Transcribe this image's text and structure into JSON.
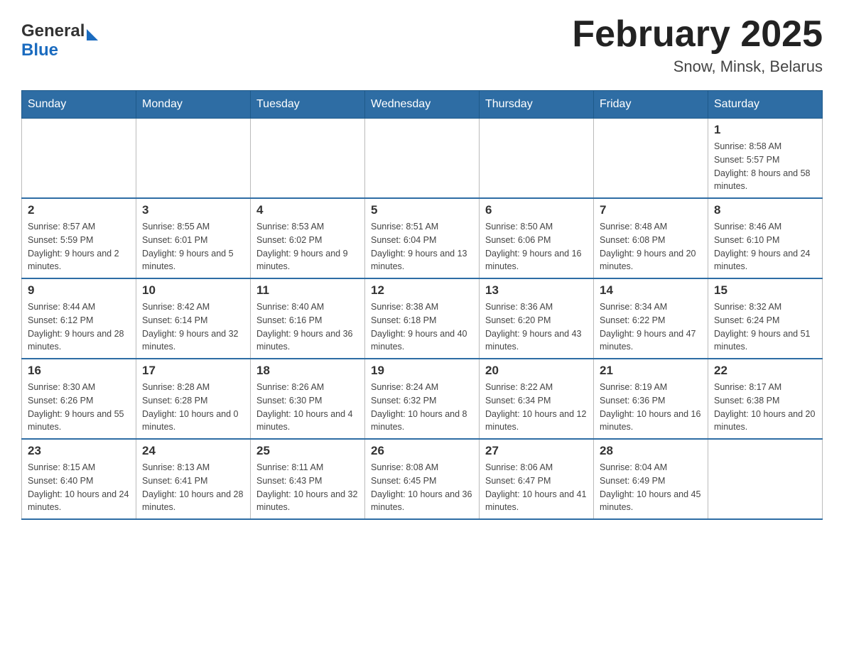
{
  "header": {
    "logo_text_general": "General",
    "logo_text_blue": "Blue",
    "title": "February 2025",
    "subtitle": "Snow, Minsk, Belarus"
  },
  "weekdays": [
    "Sunday",
    "Monday",
    "Tuesday",
    "Wednesday",
    "Thursday",
    "Friday",
    "Saturday"
  ],
  "weeks": [
    [
      {
        "day": "",
        "info": ""
      },
      {
        "day": "",
        "info": ""
      },
      {
        "day": "",
        "info": ""
      },
      {
        "day": "",
        "info": ""
      },
      {
        "day": "",
        "info": ""
      },
      {
        "day": "",
        "info": ""
      },
      {
        "day": "1",
        "info": "Sunrise: 8:58 AM\nSunset: 5:57 PM\nDaylight: 8 hours and 58 minutes."
      }
    ],
    [
      {
        "day": "2",
        "info": "Sunrise: 8:57 AM\nSunset: 5:59 PM\nDaylight: 9 hours and 2 minutes."
      },
      {
        "day": "3",
        "info": "Sunrise: 8:55 AM\nSunset: 6:01 PM\nDaylight: 9 hours and 5 minutes."
      },
      {
        "day": "4",
        "info": "Sunrise: 8:53 AM\nSunset: 6:02 PM\nDaylight: 9 hours and 9 minutes."
      },
      {
        "day": "5",
        "info": "Sunrise: 8:51 AM\nSunset: 6:04 PM\nDaylight: 9 hours and 13 minutes."
      },
      {
        "day": "6",
        "info": "Sunrise: 8:50 AM\nSunset: 6:06 PM\nDaylight: 9 hours and 16 minutes."
      },
      {
        "day": "7",
        "info": "Sunrise: 8:48 AM\nSunset: 6:08 PM\nDaylight: 9 hours and 20 minutes."
      },
      {
        "day": "8",
        "info": "Sunrise: 8:46 AM\nSunset: 6:10 PM\nDaylight: 9 hours and 24 minutes."
      }
    ],
    [
      {
        "day": "9",
        "info": "Sunrise: 8:44 AM\nSunset: 6:12 PM\nDaylight: 9 hours and 28 minutes."
      },
      {
        "day": "10",
        "info": "Sunrise: 8:42 AM\nSunset: 6:14 PM\nDaylight: 9 hours and 32 minutes."
      },
      {
        "day": "11",
        "info": "Sunrise: 8:40 AM\nSunset: 6:16 PM\nDaylight: 9 hours and 36 minutes."
      },
      {
        "day": "12",
        "info": "Sunrise: 8:38 AM\nSunset: 6:18 PM\nDaylight: 9 hours and 40 minutes."
      },
      {
        "day": "13",
        "info": "Sunrise: 8:36 AM\nSunset: 6:20 PM\nDaylight: 9 hours and 43 minutes."
      },
      {
        "day": "14",
        "info": "Sunrise: 8:34 AM\nSunset: 6:22 PM\nDaylight: 9 hours and 47 minutes."
      },
      {
        "day": "15",
        "info": "Sunrise: 8:32 AM\nSunset: 6:24 PM\nDaylight: 9 hours and 51 minutes."
      }
    ],
    [
      {
        "day": "16",
        "info": "Sunrise: 8:30 AM\nSunset: 6:26 PM\nDaylight: 9 hours and 55 minutes."
      },
      {
        "day": "17",
        "info": "Sunrise: 8:28 AM\nSunset: 6:28 PM\nDaylight: 10 hours and 0 minutes."
      },
      {
        "day": "18",
        "info": "Sunrise: 8:26 AM\nSunset: 6:30 PM\nDaylight: 10 hours and 4 minutes."
      },
      {
        "day": "19",
        "info": "Sunrise: 8:24 AM\nSunset: 6:32 PM\nDaylight: 10 hours and 8 minutes."
      },
      {
        "day": "20",
        "info": "Sunrise: 8:22 AM\nSunset: 6:34 PM\nDaylight: 10 hours and 12 minutes."
      },
      {
        "day": "21",
        "info": "Sunrise: 8:19 AM\nSunset: 6:36 PM\nDaylight: 10 hours and 16 minutes."
      },
      {
        "day": "22",
        "info": "Sunrise: 8:17 AM\nSunset: 6:38 PM\nDaylight: 10 hours and 20 minutes."
      }
    ],
    [
      {
        "day": "23",
        "info": "Sunrise: 8:15 AM\nSunset: 6:40 PM\nDaylight: 10 hours and 24 minutes."
      },
      {
        "day": "24",
        "info": "Sunrise: 8:13 AM\nSunset: 6:41 PM\nDaylight: 10 hours and 28 minutes."
      },
      {
        "day": "25",
        "info": "Sunrise: 8:11 AM\nSunset: 6:43 PM\nDaylight: 10 hours and 32 minutes."
      },
      {
        "day": "26",
        "info": "Sunrise: 8:08 AM\nSunset: 6:45 PM\nDaylight: 10 hours and 36 minutes."
      },
      {
        "day": "27",
        "info": "Sunrise: 8:06 AM\nSunset: 6:47 PM\nDaylight: 10 hours and 41 minutes."
      },
      {
        "day": "28",
        "info": "Sunrise: 8:04 AM\nSunset: 6:49 PM\nDaylight: 10 hours and 45 minutes."
      },
      {
        "day": "",
        "info": ""
      }
    ]
  ]
}
